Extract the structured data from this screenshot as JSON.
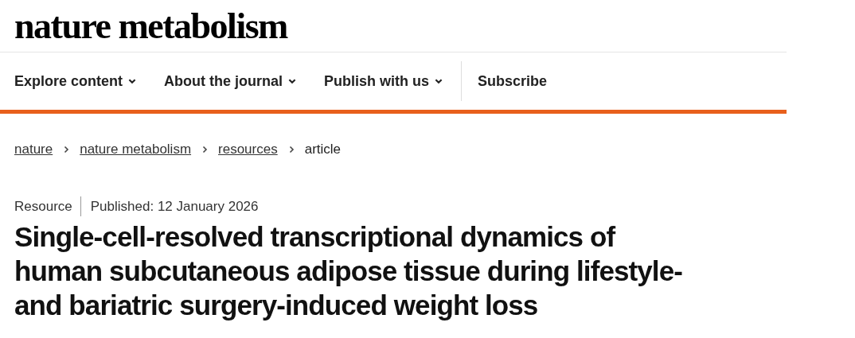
{
  "logo": "nature metabolism",
  "nav": [
    {
      "label": "Explore content",
      "kind": "dropdown"
    },
    {
      "label": "About the journal",
      "kind": "dropdown"
    },
    {
      "label": "Publish with us",
      "kind": "dropdown"
    },
    {
      "label": "Subscribe",
      "kind": "link"
    }
  ],
  "breadcrumb": [
    {
      "label": "nature",
      "kind": "link"
    },
    {
      "label": "nature metabolism",
      "kind": "link"
    },
    {
      "label": "resources",
      "kind": "link"
    },
    {
      "label": "article",
      "kind": "current"
    }
  ],
  "article": {
    "type": "Resource",
    "published": "Published: 12 January 2026",
    "title_lines": [
      "Single-cell-resolved transcriptional dynamics of",
      "human subcutaneous adipose tissue during lifestyle-",
      "and bariatric surgery-induced weight loss"
    ]
  }
}
